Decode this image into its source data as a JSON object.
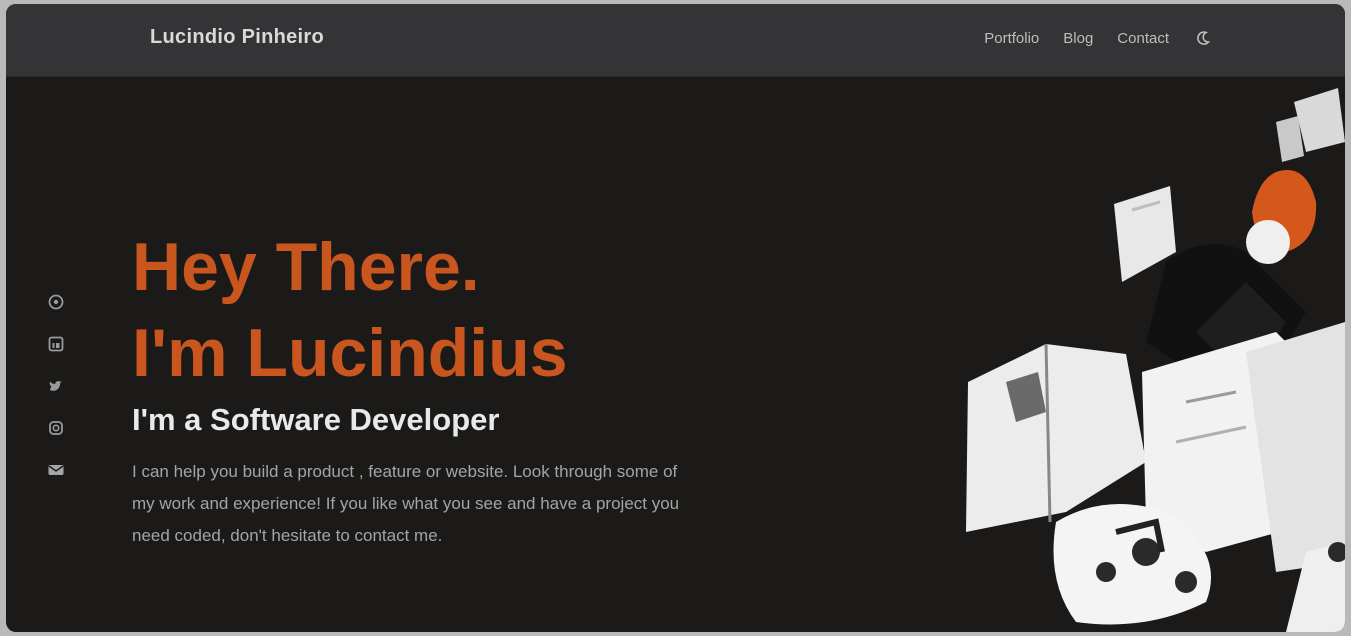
{
  "header": {
    "brand": "Lucindio Pinheiro",
    "nav": [
      "Portfolio",
      "Blog",
      "Contact"
    ],
    "theme_toggle_icon": "moon-icon"
  },
  "socials": [
    {
      "icon": "github-icon"
    },
    {
      "icon": "linkedin-icon"
    },
    {
      "icon": "twitter-icon"
    },
    {
      "icon": "instagram-icon"
    },
    {
      "icon": "email-icon"
    }
  ],
  "hero": {
    "title_line1": "Hey There.",
    "title_line2": "I'm Lucindius",
    "subtitle": "I'm a Software Developer",
    "description": "I can help you build a product , feature or website. Look through some of my work and experience! If you like what you see and have a project you need coded, don't hesitate to contact me."
  },
  "colors": {
    "accent": "#c8561e",
    "background": "#1b1a19",
    "navbar": "#343336"
  }
}
